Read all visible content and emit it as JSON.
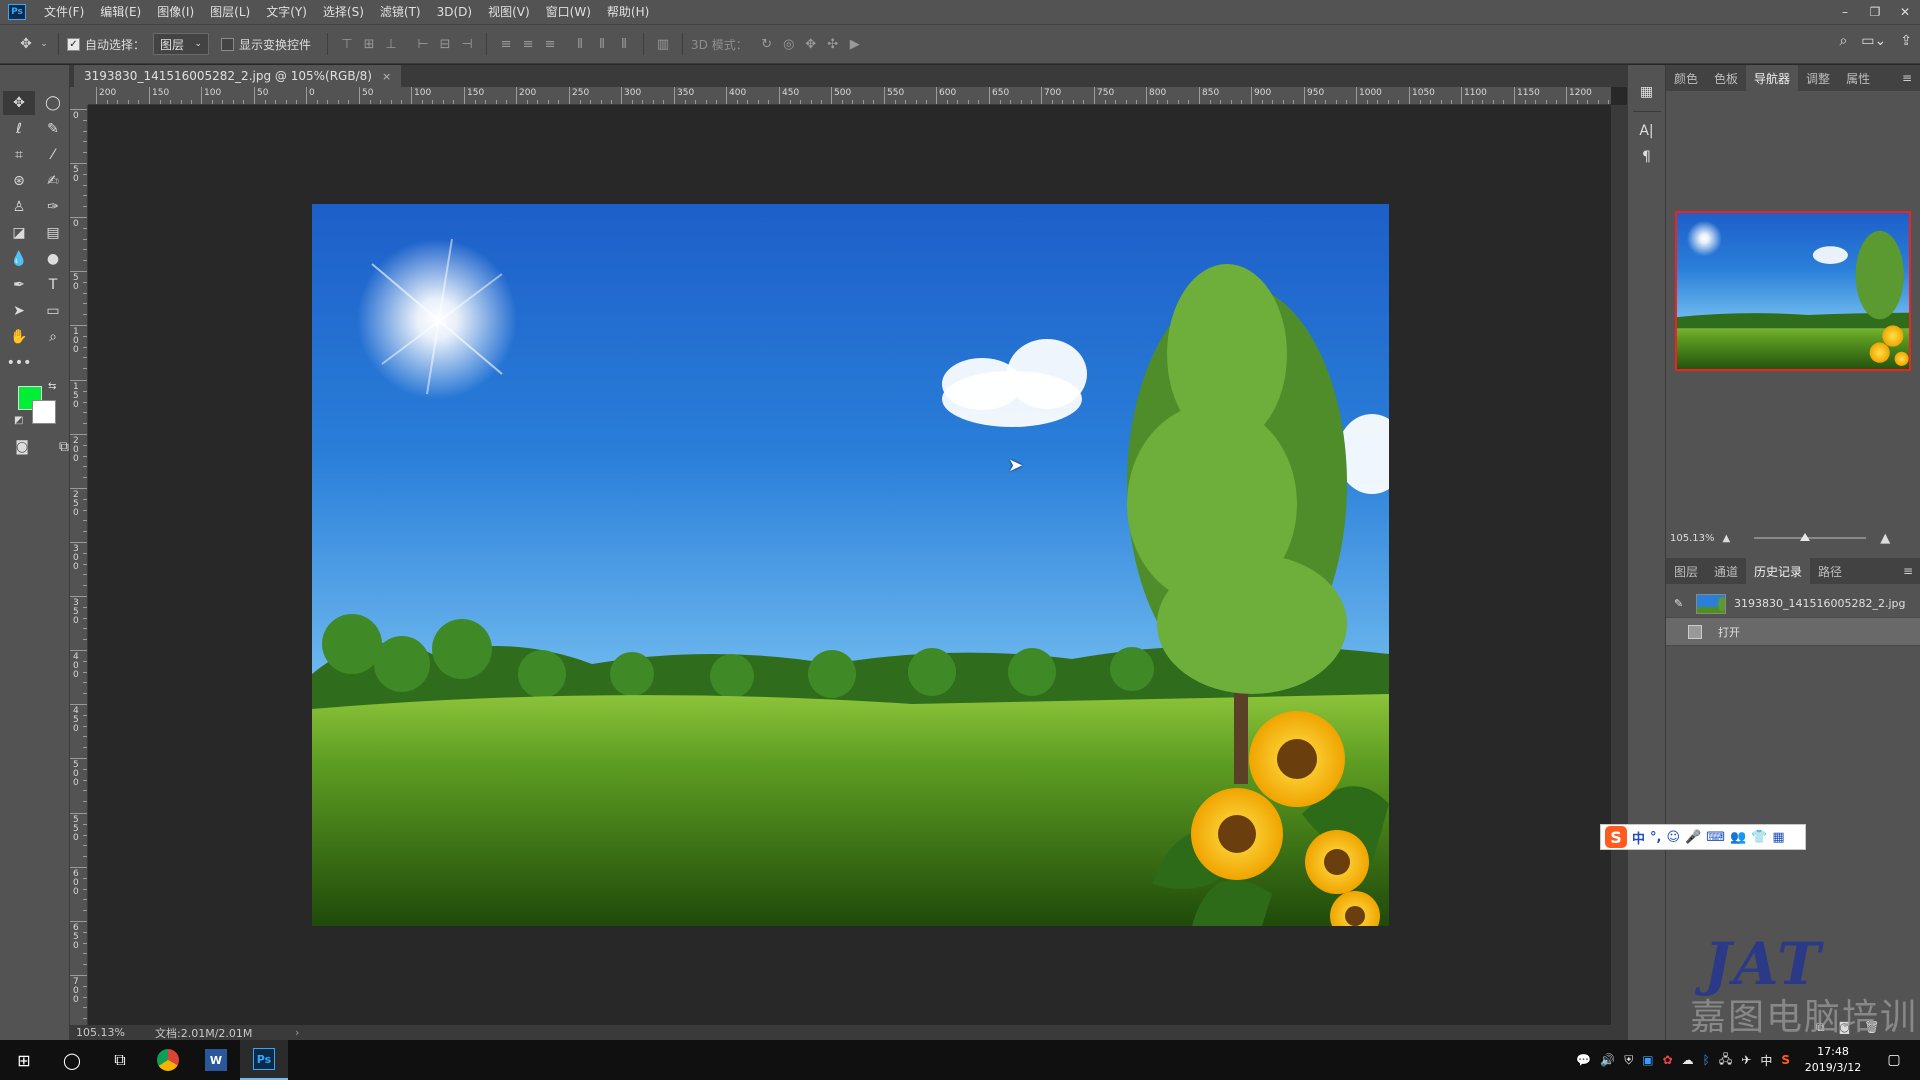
{
  "app": {
    "logo_text": "Ps"
  },
  "menu": [
    "文件(F)",
    "编辑(E)",
    "图像(I)",
    "图层(L)",
    "文字(Y)",
    "选择(S)",
    "滤镜(T)",
    "3D(D)",
    "视图(V)",
    "窗口(W)",
    "帮助(H)"
  ],
  "options": {
    "auto_select_label": "自动选择：",
    "auto_select_checked": true,
    "auto_select_value": "图层",
    "show_transform_label": "显示变换控件",
    "show_transform_checked": false,
    "mode_3d_label": "3D 模式："
  },
  "document": {
    "tab_title": "3193830_141516005282_2.jpg @ 105%(RGB/8)",
    "close_glyph": "×"
  },
  "ruler": {
    "top_labels": [
      "200",
      "150",
      "100",
      "50",
      "0",
      "50",
      "100",
      "150",
      "200",
      "250",
      "300",
      "350",
      "400",
      "450",
      "500",
      "550",
      "600",
      "650",
      "700",
      "750",
      "800",
      "850",
      "900",
      "950",
      "1000",
      "1050",
      "1100",
      "1150",
      "1200"
    ],
    "left_labels": [
      "0",
      "50",
      "0",
      "50",
      "100",
      "150",
      "200",
      "250",
      "300",
      "350",
      "400",
      "450",
      "500",
      "550",
      "600",
      "650",
      "700"
    ]
  },
  "colors": {
    "foreground": "#00ee33",
    "background": "#ffffff",
    "accent": "#31a8ff",
    "nav_frame": "#ee2222"
  },
  "status": {
    "zoom": "105.13%",
    "doc_size": "文档:2.01M/2.01M",
    "arrow": "›"
  },
  "right_panel": {
    "top_tabs": [
      "颜色",
      "色板",
      "导航器",
      "调整",
      "属性"
    ],
    "top_active": 2,
    "nav_zoom": "105.13%",
    "nav_zoom_fraction": 0.45,
    "bottom_tabs": [
      "图层",
      "通道",
      "历史记录",
      "路径"
    ],
    "bottom_active": 2,
    "history": [
      {
        "label": "3193830_141516005282_2.jpg",
        "type": "snapshot"
      },
      {
        "label": "打开",
        "type": "step"
      }
    ]
  },
  "ime": {
    "logo": "S",
    "items": [
      "中",
      "°,",
      "☺",
      "🎤",
      "⌨",
      "👥",
      "👕",
      "▦"
    ]
  },
  "watermark": {
    "logo": "JAT",
    "text": "嘉图电脑培训"
  },
  "taskbar": {
    "time": "17:48",
    "date": "2019/3/12",
    "ime_lang": "中"
  }
}
